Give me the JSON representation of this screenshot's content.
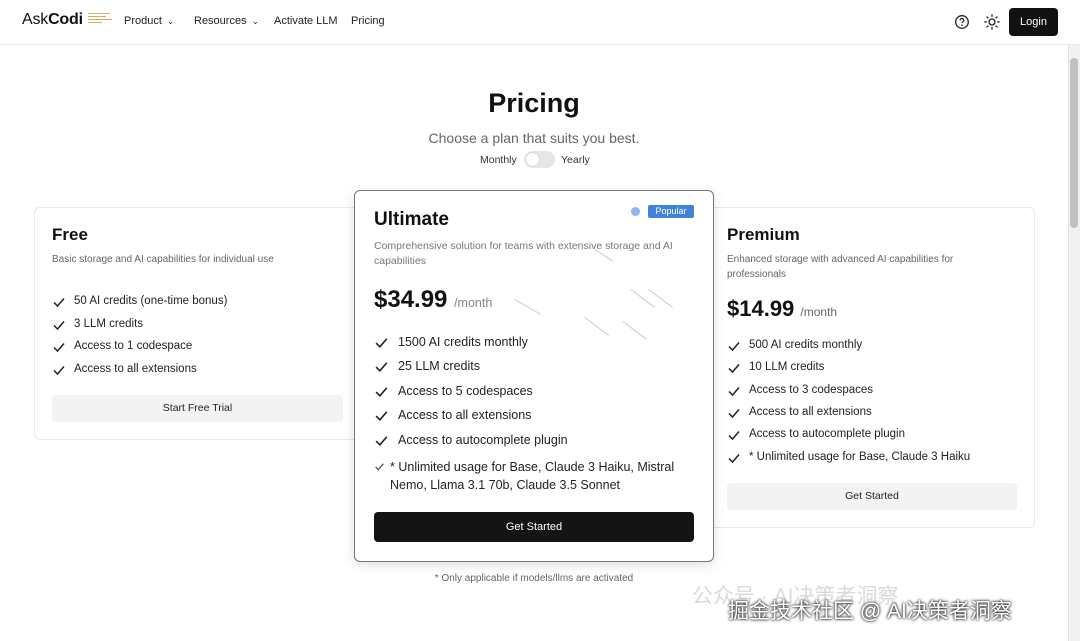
{
  "nav": {
    "logo_part1": "Ask",
    "logo_part2": "Codi",
    "items": [
      {
        "label": "Product",
        "has_dropdown": true
      },
      {
        "label": "Resources",
        "has_dropdown": true
      },
      {
        "label": "Activate LLM",
        "has_dropdown": false
      },
      {
        "label": "Pricing",
        "has_dropdown": false
      }
    ],
    "help_icon": "question-circle-icon",
    "theme_icon": "sun-icon",
    "login_label": "Login"
  },
  "header": {
    "title": "Pricing",
    "subtitle": "Choose a plan that suits you best.",
    "toggle_left": "Monthly",
    "toggle_right": "Yearly",
    "yearly_selected": false
  },
  "plans": {
    "free": {
      "name": "Free",
      "description": "Basic storage and AI capabilities for individual use",
      "features": [
        "50 AI credits (one-time bonus)",
        "3 LLM credits",
        "Access to 1 codespace",
        "Access to all extensions"
      ],
      "button": "Start Free Trial"
    },
    "ultimate": {
      "name": "Ultimate",
      "badge": "Popular",
      "description": "Comprehensive solution for teams with extensive storage and AI capabilities",
      "price": "$34.99",
      "period": "/month",
      "features": [
        "1500 AI credits monthly",
        "25 LLM credits",
        "Access to 5 codespaces",
        "Access to all extensions",
        "Access to autocomplete plugin",
        "* Unlimited usage for Base, Claude 3 Haiku, Mistral Nemo, Llama 3.1 70b, Claude 3.5 Sonnet"
      ],
      "button": "Get Started"
    },
    "premium": {
      "name": "Premium",
      "description": "Enhanced storage with advanced AI capabilities for professionals",
      "price": "$14.99",
      "period": "/month",
      "features": [
        "500 AI credits monthly",
        "10 LLM credits",
        "Access to 3 codespaces",
        "Access to all extensions",
        "Access to autocomplete plugin",
        "* Unlimited usage for Base, Claude 3 Haiku"
      ],
      "button": "Get Started"
    }
  },
  "footnote": "* Only applicable if models/llms are activated",
  "watermark": {
    "line1": "公众号 · AI决策者洞察",
    "line2": "掘金技术社区 @ AI决策者洞察"
  },
  "colors": {
    "accent": "#3f82db",
    "dark_button": "#141414",
    "light_button": "#f3f3f3"
  }
}
